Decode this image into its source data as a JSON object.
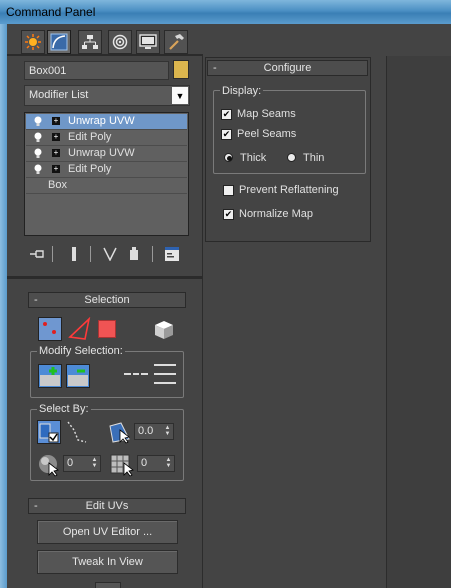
{
  "window": {
    "title": "Command Panel"
  },
  "tabs": [
    {
      "name": "create",
      "icon": "sun-icon"
    },
    {
      "name": "modify",
      "icon": "curve-icon"
    },
    {
      "name": "hierarchy",
      "icon": "hierarchy-icon"
    },
    {
      "name": "motion",
      "icon": "motion-icon"
    },
    {
      "name": "display",
      "icon": "monitor-icon"
    },
    {
      "name": "utilities",
      "icon": "hammer-icon"
    }
  ],
  "object": {
    "name": "Box001",
    "color": "#dcb64e"
  },
  "modifier_list": {
    "value": "Modifier List"
  },
  "stack": [
    {
      "label": "Unwrap UVW",
      "selected": true
    },
    {
      "label": "Edit Poly",
      "selected": false
    },
    {
      "label": "Unwrap UVW",
      "selected": false
    },
    {
      "label": "Edit Poly",
      "selected": false
    },
    {
      "label": "Box",
      "selected": false
    }
  ],
  "selection": {
    "title": "Selection",
    "modify_selection_label": "Modify Selection:",
    "select_by_label": "Select By:",
    "angle_value": "0.0",
    "spin1_value": "0",
    "spin2_value": "0"
  },
  "edit_uvs": {
    "title": "Edit UVs",
    "open_editor": "Open UV Editor ...",
    "tweak": "Tweak In View"
  },
  "configure": {
    "title": "Configure",
    "display_label": "Display:",
    "map_seams": "Map Seams",
    "peel_seams": "Peel Seams",
    "thick": "Thick",
    "thin": "Thin",
    "prevent_reflattening": "Prevent Reflattening",
    "normalize_map": "Normalize Map",
    "map_seams_checked": true,
    "peel_seams_checked": true,
    "thick_selected": true,
    "prevent_reflattening_checked": false,
    "normalize_map_checked": true
  },
  "rollout_minus": "-"
}
